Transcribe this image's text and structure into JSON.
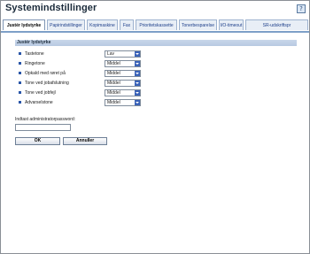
{
  "window": {
    "title": "Systemindstillinger"
  },
  "tabs": [
    {
      "label": "Justér lydstyrke",
      "active": true
    },
    {
      "label": "Papirindstillinger",
      "active": false
    },
    {
      "label": "Kopimaskine",
      "active": false
    },
    {
      "label": "Fax",
      "active": false
    },
    {
      "label": "Prioritetskassette",
      "active": false
    },
    {
      "label": "Tonerbesparelse",
      "active": false
    },
    {
      "label": "I/O-timeout",
      "active": false
    },
    {
      "label": "SR-udskriftspr",
      "active": false
    }
  ],
  "section": {
    "title": "Justér lydstyrke"
  },
  "settings": [
    {
      "label": "Tastetone",
      "value": "Lav"
    },
    {
      "label": "Ringetone",
      "value": "Middel"
    },
    {
      "label": "Opkald med røret på",
      "value": "Middel"
    },
    {
      "label": "Tone ved jobafslutning",
      "value": "Middel"
    },
    {
      "label": "Tone ved jobfejl",
      "value": "Middel"
    },
    {
      "label": "Advarselstone",
      "value": "Middel"
    }
  ],
  "password": {
    "label": "Indtast administratorpassword:",
    "value": ""
  },
  "buttons": {
    "ok": "OK",
    "cancel": "Annuller"
  },
  "colors": {
    "accent": "#2a56a8",
    "section_header": "#c9d7ea",
    "tab_border": "#7ea0c8"
  }
}
